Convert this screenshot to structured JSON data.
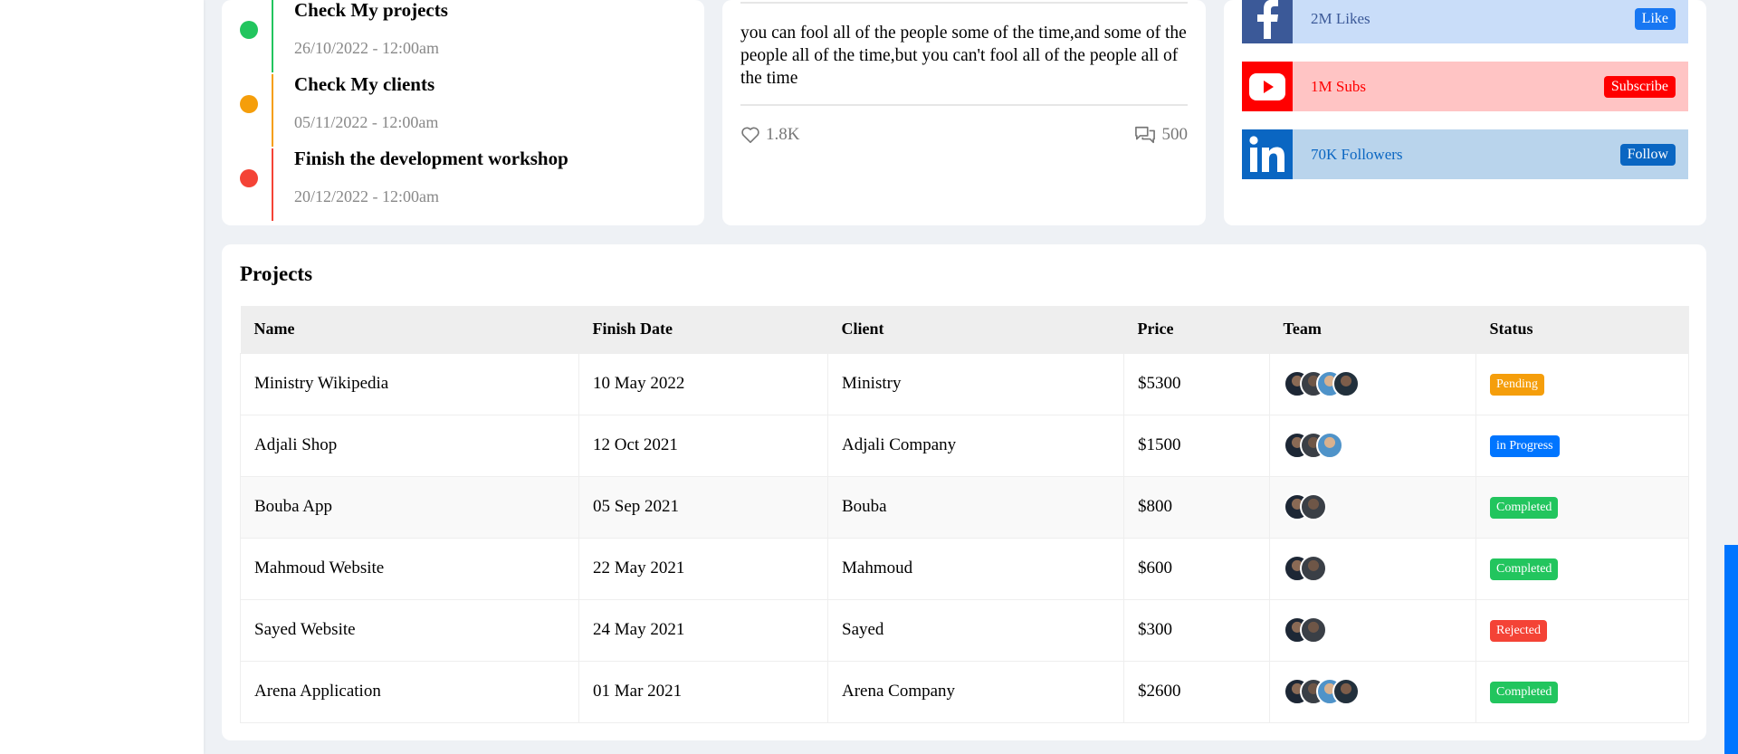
{
  "tasks": [
    {
      "title": "Check My projects",
      "date": "26/10/2022 - 12:00am",
      "color": "#22c55e"
    },
    {
      "title": "Check My clients",
      "date": "05/11/2022 - 12:00am",
      "color": "#f59e0b"
    },
    {
      "title": "Finish the development workshop",
      "date": "20/12/2022 - 12:00am",
      "color": "#f44336"
    }
  ],
  "quote": {
    "text": "you can fool all of the people some of the time,and some of the people all of the time,but you can't fool all of the people all of the time",
    "likes": "1.8K",
    "comments": "500"
  },
  "social": [
    {
      "network": "facebook",
      "icon": "facebook-icon",
      "text": "2M Likes",
      "button": "Like",
      "bg": "#c9ddf9",
      "logo_bg": "#3b5998",
      "text_color": "#3b5998",
      "btn_bg": "#1877f2"
    },
    {
      "network": "youtube",
      "icon": "youtube-icon",
      "text": "1M Subs",
      "button": "Subscribe",
      "bg": "#ffc4c4",
      "logo_bg": "#ff0000",
      "text_color": "#ff0000",
      "btn_bg": "#ff0000"
    },
    {
      "network": "linkedin",
      "icon": "linkedin-icon",
      "text": "70K Followers",
      "button": "Follow",
      "bg": "#b9d4ec",
      "logo_bg": "#0a66c2",
      "text_color": "#0a66c2",
      "btn_bg": "#0a66c2"
    }
  ],
  "projects": {
    "title": "Projects",
    "columns": [
      "Name",
      "Finish Date",
      "Client",
      "Price",
      "Team",
      "Status"
    ],
    "rows": [
      {
        "name": "Ministry Wikipedia",
        "date": "10 May 2022",
        "client": "Ministry",
        "price": "$5300",
        "team": 4,
        "status": "Pending",
        "status_color": "#f59e0b"
      },
      {
        "name": "Adjali Shop",
        "date": "12 Oct 2021",
        "client": "Adjali Company",
        "price": "$1500",
        "team": 3,
        "status": "in Progress",
        "status_color": "#0075ff"
      },
      {
        "name": "Bouba App",
        "date": "05 Sep 2021",
        "client": "Bouba",
        "price": "$800",
        "team": 2,
        "status": "Completed",
        "status_color": "#22c55e"
      },
      {
        "name": "Mahmoud Website",
        "date": "22 May 2021",
        "client": "Mahmoud",
        "price": "$600",
        "team": 2,
        "status": "Completed",
        "status_color": "#22c55e"
      },
      {
        "name": "Sayed Website",
        "date": "24 May 2021",
        "client": "Sayed",
        "price": "$300",
        "team": 2,
        "status": "Rejected",
        "status_color": "#f44336"
      },
      {
        "name": "Arena Application",
        "date": "01 Mar 2021",
        "client": "Arena Company",
        "price": "$2600",
        "team": 4,
        "status": "Completed",
        "status_color": "#22c55e"
      }
    ]
  }
}
